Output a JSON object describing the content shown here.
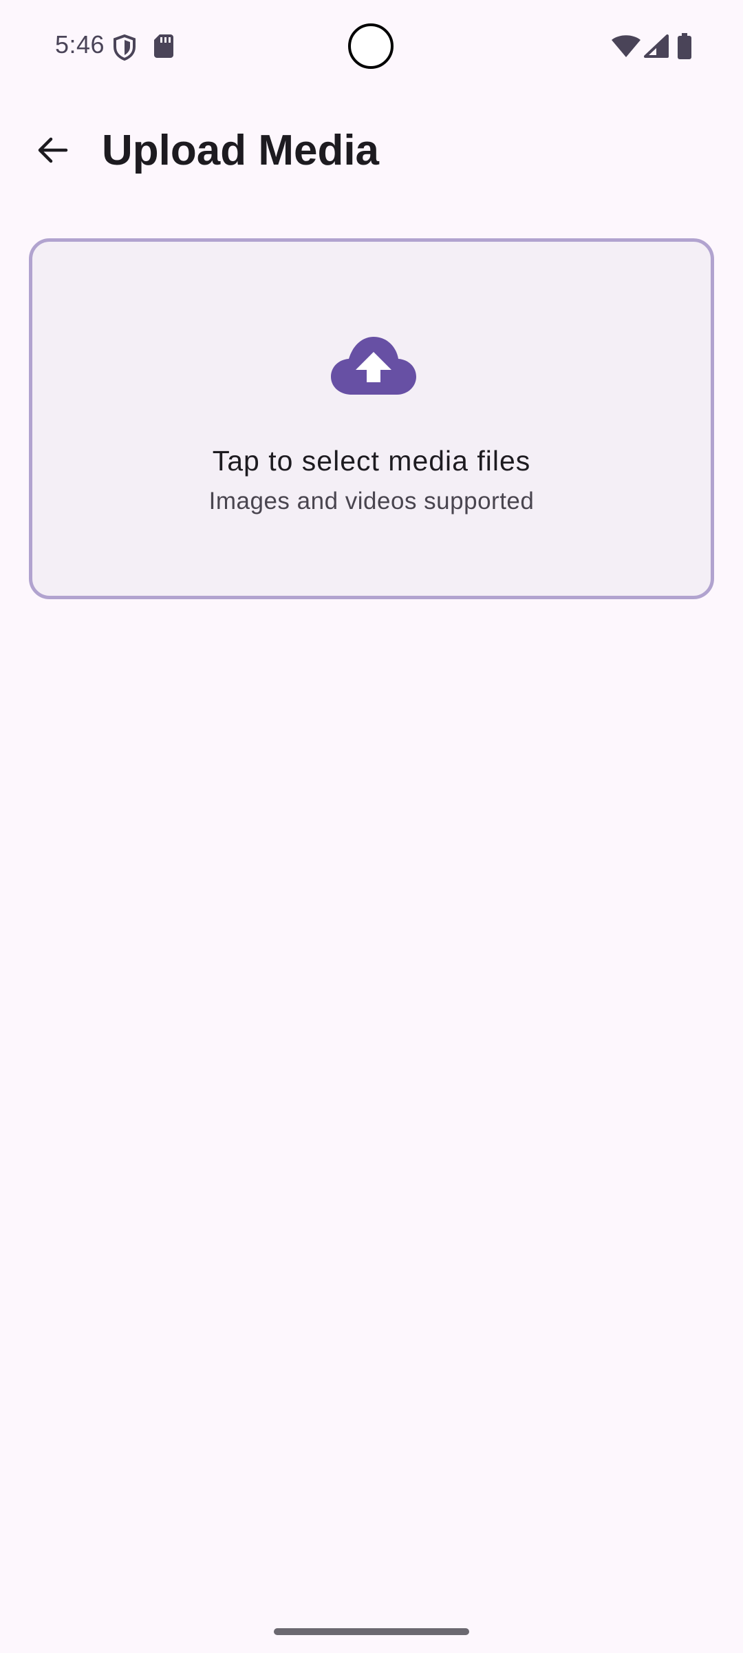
{
  "status_bar": {
    "time": "5:46",
    "icons": [
      "shield-icon",
      "sdcard-icon",
      "wifi-icon",
      "signal-icon",
      "battery-icon"
    ]
  },
  "app_bar": {
    "title": "Upload Media",
    "back_icon": "arrow-back-icon"
  },
  "upload_card": {
    "icon": "cloud-upload-icon",
    "title": "Tap to select media files",
    "subtitle": "Images and videos supported"
  },
  "colors": {
    "background": "#fdf7fd",
    "card_background": "#f4eff6",
    "card_border": "#b1a3cf",
    "accent": "#6750a4",
    "title_text": "#1d1b20",
    "secondary_text": "#49454f"
  }
}
